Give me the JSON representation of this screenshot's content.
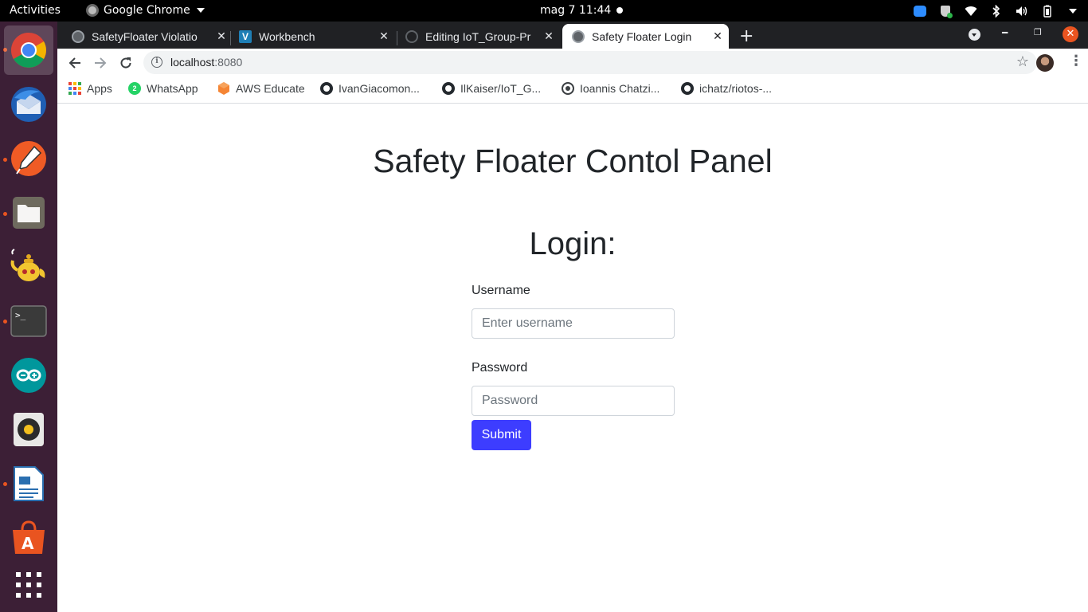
{
  "system_bar": {
    "activities": "Activities",
    "app_name": "Google Chrome",
    "clock": "mag 7  11:44"
  },
  "dock": {
    "items": [
      {
        "name": "Google Chrome",
        "icon": "chrome-icon",
        "running": true,
        "active": true
      },
      {
        "name": "Thunderbird",
        "icon": "thunderbird-icon",
        "running": false
      },
      {
        "name": "Postman",
        "icon": "postman-icon",
        "running": true
      },
      {
        "name": "Files",
        "icon": "files-icon",
        "running": true
      },
      {
        "name": "Genie",
        "icon": "teapot-icon",
        "running": false
      },
      {
        "name": "Terminal",
        "icon": "terminal-icon",
        "running": true
      },
      {
        "name": "Arduino",
        "icon": "arduino-icon",
        "running": false
      },
      {
        "name": "Rhythmbox",
        "icon": "rhythmbox-icon",
        "running": false
      },
      {
        "name": "LibreOffice Writer",
        "icon": "writer-icon",
        "running": true
      },
      {
        "name": "Ubuntu Software",
        "icon": "software-center-icon",
        "running": false
      },
      {
        "name": "Show Applications",
        "icon": "app-grid-icon",
        "running": false
      }
    ]
  },
  "browser": {
    "tabs": [
      {
        "title": "SafetyFloater Violatio",
        "active": false
      },
      {
        "title": "Workbench",
        "active": false
      },
      {
        "title": "Editing IoT_Group-Pr",
        "active": false
      },
      {
        "title": "Safety Floater Login",
        "active": true
      }
    ],
    "new_tab": "+",
    "url_host": "localhost",
    "url_port": ":8080",
    "bookmarks": [
      {
        "label": "Apps",
        "icon": "apps-grid-icon"
      },
      {
        "label": "WhatsApp",
        "icon": "whatsapp-icon"
      },
      {
        "label": "AWS Educate",
        "icon": "aws-educate-icon"
      },
      {
        "label": "IvanGiacomon...",
        "icon": "github-icon"
      },
      {
        "label": "IlKaiser/IoT_G...",
        "icon": "github-icon"
      },
      {
        "label": "Ioannis Chatzi...",
        "icon": "globe-icon"
      },
      {
        "label": "ichatz/riotos-...",
        "icon": "github-icon"
      }
    ]
  },
  "page": {
    "title": "Safety Floater Contol Panel",
    "login_heading": "Login:",
    "username_label": "Username",
    "username_placeholder": "Enter username",
    "password_label": "Password",
    "password_placeholder": "Password",
    "submit_label": "Submit"
  },
  "colors": {
    "submit_button": "#3d3dff",
    "dock_background": "#3c1f36",
    "tabstrip": "#202124",
    "accent_orange": "#e95420"
  }
}
